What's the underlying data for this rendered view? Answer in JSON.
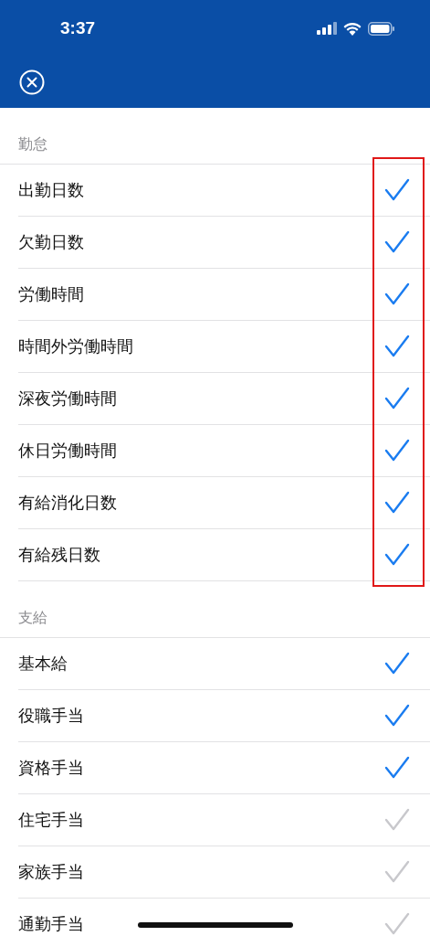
{
  "status_bar": {
    "time": "3:37"
  },
  "sections": [
    {
      "title": "勤怠",
      "highlighted": true,
      "items": [
        {
          "label": "出勤日数",
          "checked": true
        },
        {
          "label": "欠勤日数",
          "checked": true
        },
        {
          "label": "労働時間",
          "checked": true
        },
        {
          "label": "時間外労働時間",
          "checked": true
        },
        {
          "label": "深夜労働時間",
          "checked": true
        },
        {
          "label": "休日労働時間",
          "checked": true
        },
        {
          "label": "有給消化日数",
          "checked": true
        },
        {
          "label": "有給残日数",
          "checked": true
        }
      ]
    },
    {
      "title": "支給",
      "highlighted": false,
      "items": [
        {
          "label": "基本給",
          "checked": true
        },
        {
          "label": "役職手当",
          "checked": true
        },
        {
          "label": "資格手当",
          "checked": true
        },
        {
          "label": "住宅手当",
          "checked": false
        },
        {
          "label": "家族手当",
          "checked": false
        },
        {
          "label": "通勤手当",
          "checked": false
        }
      ]
    }
  ]
}
